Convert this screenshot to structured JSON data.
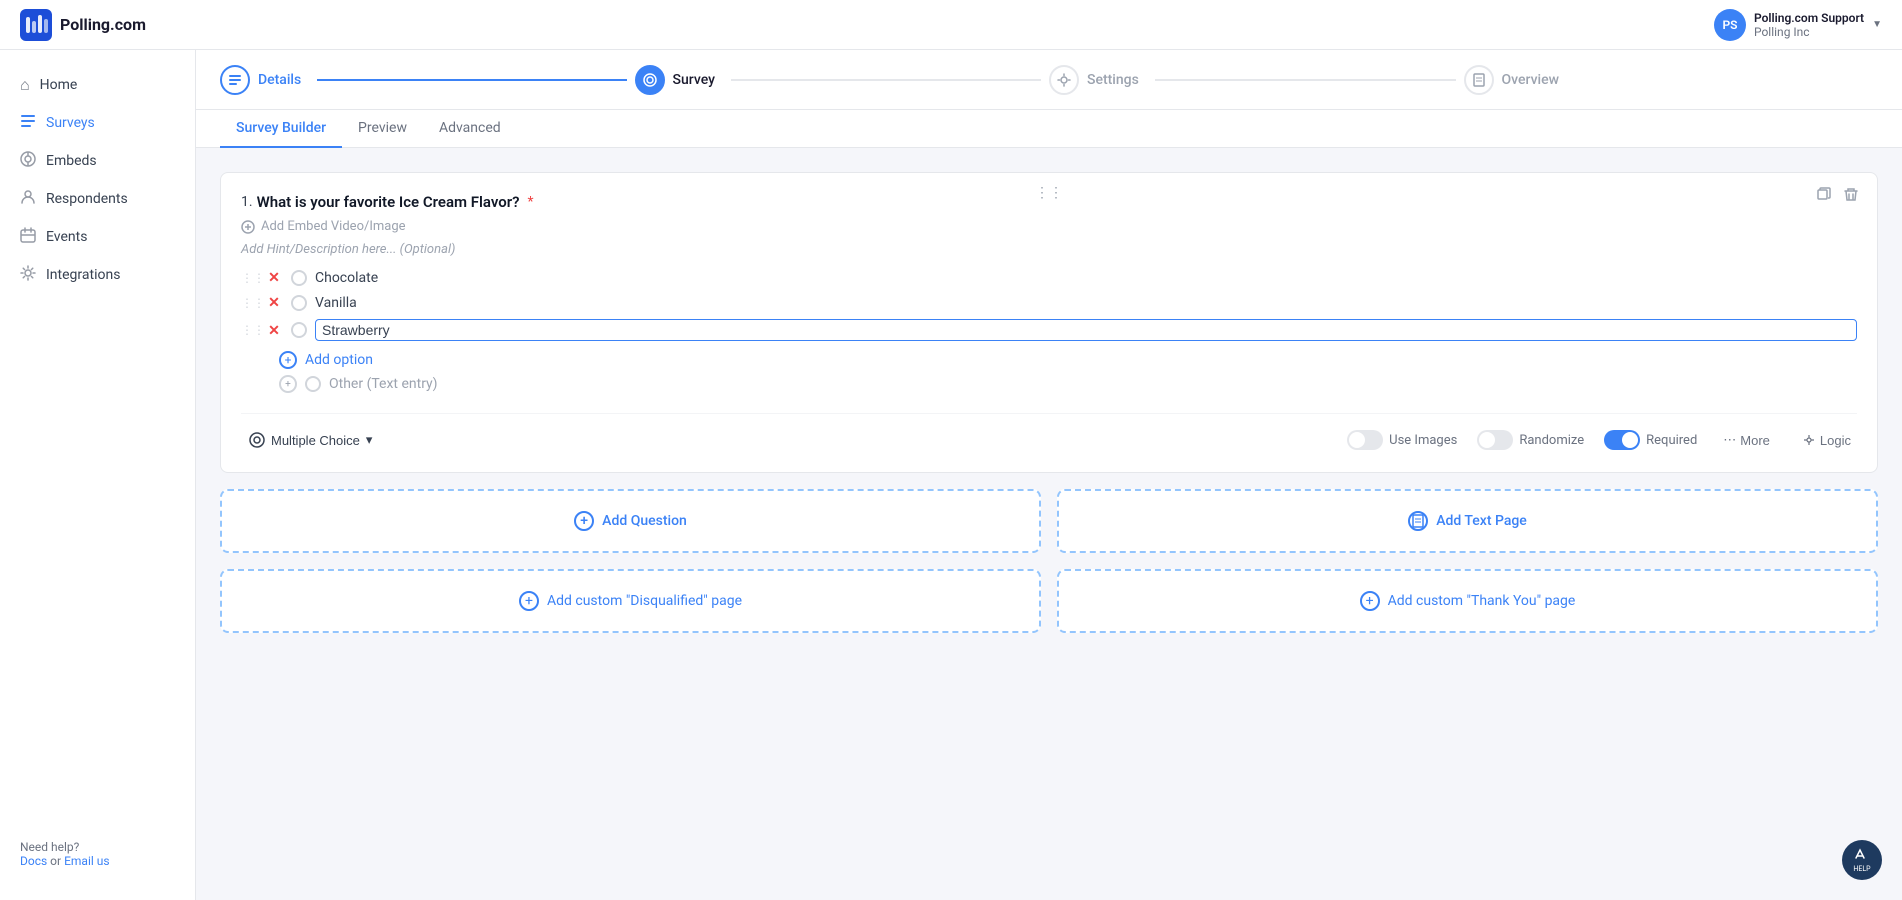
{
  "header": {
    "logo_text": "Polling.com",
    "user_initials": "PS",
    "user_name": "Polling.com Support",
    "user_org": "Polling Inc",
    "chevron": "▼"
  },
  "sidebar": {
    "items": [
      {
        "id": "home",
        "label": "Home",
        "icon": "⌂"
      },
      {
        "id": "surveys",
        "label": "Surveys",
        "icon": "≡",
        "active": true
      },
      {
        "id": "embeds",
        "label": "Embeds",
        "icon": "◈"
      },
      {
        "id": "respondents",
        "label": "Respondents",
        "icon": "👤"
      },
      {
        "id": "events",
        "label": "Events",
        "icon": "📅"
      },
      {
        "id": "integrations",
        "label": "Integrations",
        "icon": "⚙"
      }
    ],
    "footer": {
      "help_text": "Need help?",
      "docs_label": "Docs",
      "or_label": " or ",
      "email_label": "Email us"
    }
  },
  "wizard": {
    "steps": [
      {
        "id": "details",
        "label": "Details",
        "icon": "≡",
        "state": "completed"
      },
      {
        "id": "survey",
        "label": "Survey",
        "icon": "🔍",
        "state": "active"
      },
      {
        "id": "settings",
        "label": "Settings",
        "icon": "⚙",
        "state": "inactive"
      },
      {
        "id": "overview",
        "label": "Overview",
        "icon": "📄",
        "state": "inactive"
      }
    ]
  },
  "sub_tabs": {
    "tabs": [
      {
        "id": "survey-builder",
        "label": "Survey Builder",
        "active": true
      },
      {
        "id": "preview",
        "label": "Preview",
        "active": false
      },
      {
        "id": "advanced",
        "label": "Advanced",
        "active": false
      }
    ]
  },
  "question": {
    "number": "1.",
    "text": "What is your favorite Ice Cream Flavor?",
    "required": true,
    "required_marker": "*",
    "embed_label": "Add Embed Video/Image",
    "hint_placeholder": "Add Hint/Description here... (Optional)",
    "options": [
      {
        "id": "opt1",
        "text": "Chocolate"
      },
      {
        "id": "opt2",
        "text": "Vanilla"
      },
      {
        "id": "opt3",
        "text": "Strawberry",
        "editing": true
      }
    ],
    "add_option_label": "Add option",
    "other_label": "Other (Text entry)",
    "type": "Multiple Choice",
    "type_chevron": "▾",
    "controls": {
      "use_images_label": "Use Images",
      "randomize_label": "Randomize",
      "required_label": "Required",
      "required_on": true,
      "more_label": "More",
      "logic_label": "Logic"
    }
  },
  "add_buttons": {
    "add_question_label": "Add Question",
    "add_text_page_label": "Add Text Page"
  },
  "custom_pages": {
    "disqualified_label": "Add custom \"Disqualified\" page",
    "thank_you_label": "Add custom \"Thank You\" page"
  },
  "help": {
    "label": "HELP"
  }
}
